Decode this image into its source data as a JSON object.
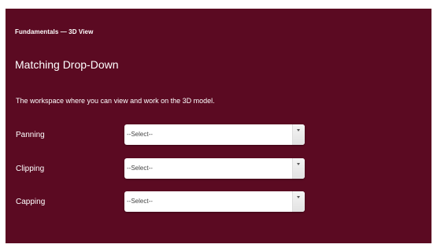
{
  "breadcrumb": "Fundamentals — 3D View",
  "title": "Matching Drop-Down",
  "instructions": "The workspace where you can view and work on the 3D model.",
  "rows": [
    {
      "label": "Panning",
      "selected": "--Select--"
    },
    {
      "label": "Clipping",
      "selected": "--Select--"
    },
    {
      "label": "Capping",
      "selected": "--Select--"
    }
  ],
  "colors": {
    "panel_background": "#5b0a22",
    "text": "#ffffff",
    "select_background": "#ffffff"
  },
  "icons": {
    "dropdown": "chevron-down-icon"
  }
}
